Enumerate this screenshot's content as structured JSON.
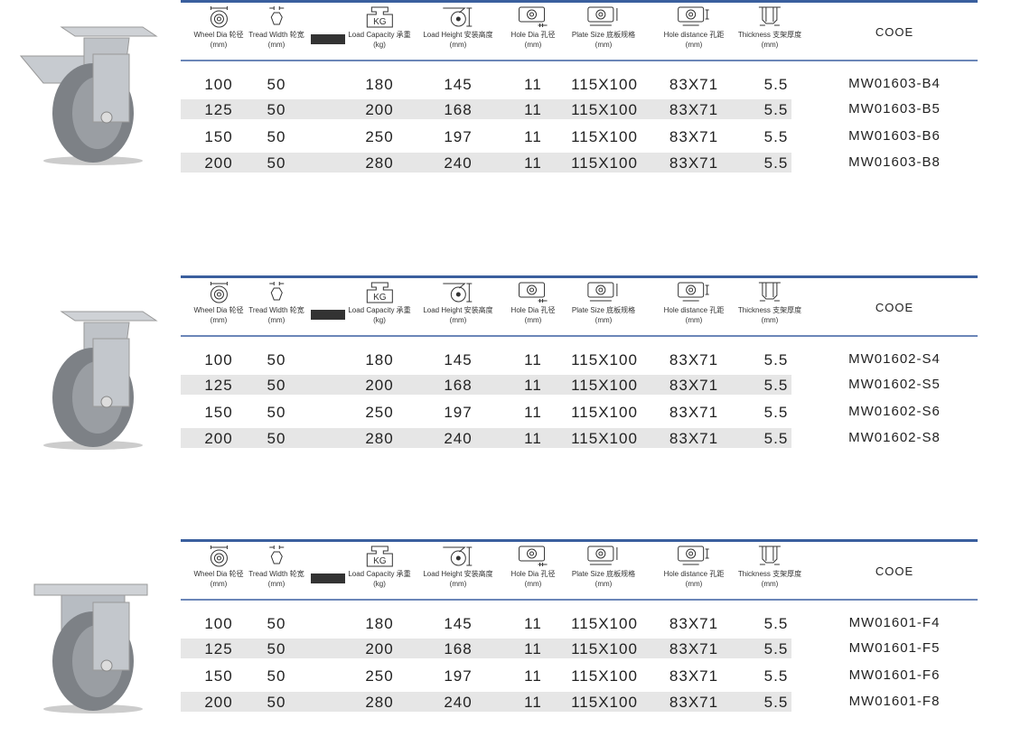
{
  "headers": [
    {
      "icon": "wheel-dia-icon",
      "label": "Wheel Dia 轮径",
      "unit": "(mm)"
    },
    {
      "icon": "tread-width-icon",
      "label": "Tread Width 轮宽",
      "unit": "(mm)"
    },
    {
      "icon": "kg-weight-icon",
      "label": "Load Capacity 承重",
      "unit": "(kg)"
    },
    {
      "icon": "load-height-icon",
      "label": "Load Height 安装高度",
      "unit": "(mm)"
    },
    {
      "icon": "hole-dia-icon",
      "label": "Hole Dia 孔径",
      "unit": "(mm)"
    },
    {
      "icon": "plate-size-icon",
      "label": "Plate Size 底板规格",
      "unit": "(mm)"
    },
    {
      "icon": "hole-distance-icon",
      "label": "Hole distance 孔距",
      "unit": "(mm)"
    },
    {
      "icon": "thickness-icon",
      "label": "Thickness 支架厚度",
      "unit": "(mm)"
    }
  ],
  "kg_icon_text": "KG",
  "code_header": "COOE",
  "accent": "#3a5f9e",
  "tables": [
    {
      "product": "swivel caster with brake",
      "rows": [
        [
          "100",
          "50",
          "180",
          "145",
          "11",
          "115X100",
          "83X71",
          "5.5",
          "MW01603-B4"
        ],
        [
          "125",
          "50",
          "200",
          "168",
          "11",
          "115X100",
          "83X71",
          "5.5",
          "MW01603-B5"
        ],
        [
          "150",
          "50",
          "250",
          "197",
          "11",
          "115X100",
          "83X71",
          "5.5",
          "MW01603-B6"
        ],
        [
          "200",
          "50",
          "280",
          "240",
          "11",
          "115X100",
          "83X71",
          "5.5",
          "MW01603-B8"
        ]
      ]
    },
    {
      "product": "swivel caster",
      "rows": [
        [
          "100",
          "50",
          "180",
          "145",
          "11",
          "115X100",
          "83X71",
          "5.5",
          "MW01602-S4"
        ],
        [
          "125",
          "50",
          "200",
          "168",
          "11",
          "115X100",
          "83X71",
          "5.5",
          "MW01602-S5"
        ],
        [
          "150",
          "50",
          "250",
          "197",
          "11",
          "115X100",
          "83X71",
          "5.5",
          "MW01602-S6"
        ],
        [
          "200",
          "50",
          "280",
          "240",
          "11",
          "115X100",
          "83X71",
          "5.5",
          "MW01602-S8"
        ]
      ]
    },
    {
      "product": "rigid caster",
      "rows": [
        [
          "100",
          "50",
          "180",
          "145",
          "11",
          "115X100",
          "83X71",
          "5.5",
          "MW01601-F4"
        ],
        [
          "125",
          "50",
          "200",
          "168",
          "11",
          "115X100",
          "83X71",
          "5.5",
          "MW01601-F5"
        ],
        [
          "150",
          "50",
          "250",
          "197",
          "11",
          "115X100",
          "83X71",
          "5.5",
          "MW01601-F6"
        ],
        [
          "200",
          "50",
          "280",
          "240",
          "11",
          "115X100",
          "83X71",
          "5.5",
          "MW01601-F8"
        ]
      ]
    }
  ]
}
